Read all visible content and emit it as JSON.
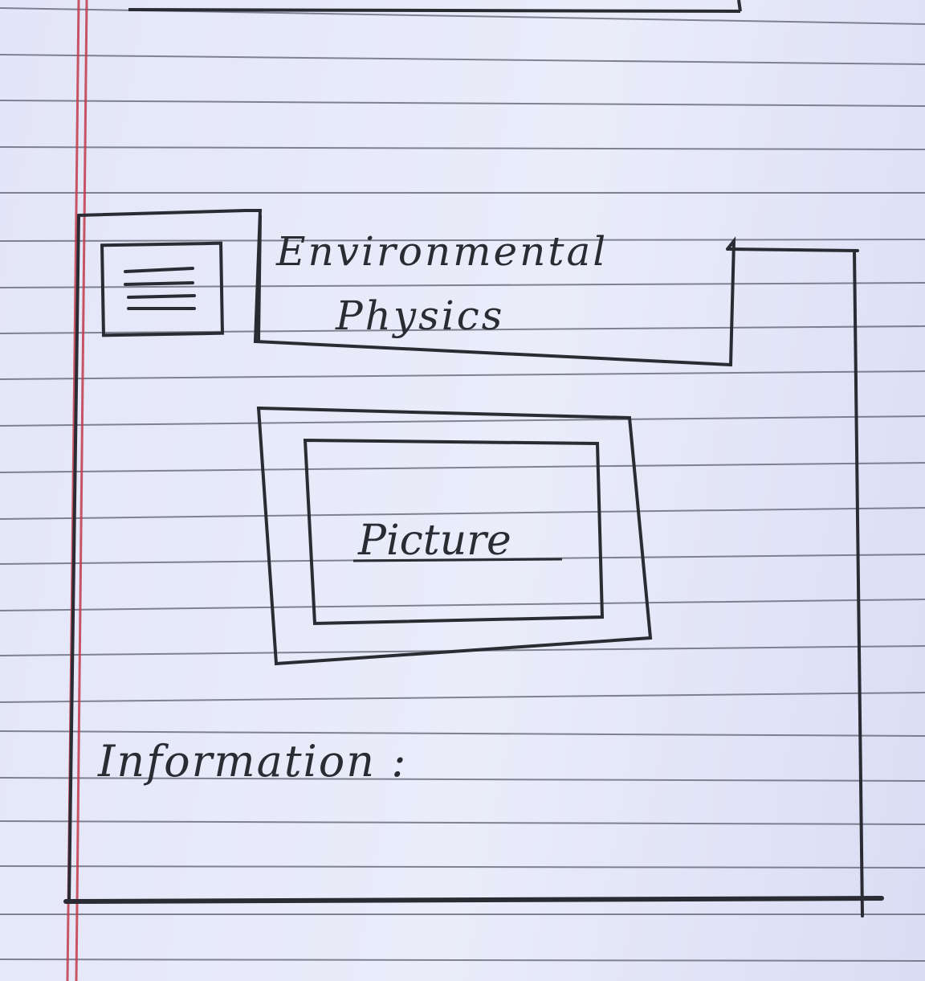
{
  "header": {
    "menu_icon": "hamburger-menu-icon",
    "title_line1": "Environmental",
    "title_line2": "Physics"
  },
  "picture": {
    "label": "Picture"
  },
  "info": {
    "label": "Information :"
  },
  "colors": {
    "paper": "#e3e6f8",
    "rule_line": "#5b5f6e",
    "margin_line": "#c23a4a",
    "ink": "#2a2b33"
  }
}
